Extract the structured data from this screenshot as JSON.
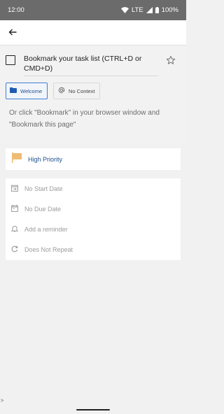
{
  "status_bar": {
    "time": "12:00",
    "network": "LTE",
    "battery": "100%"
  },
  "icons": {
    "back": "arrow-left-icon",
    "star": "star-outline-icon",
    "welcome": "folder-icon",
    "context": "at-sign-icon",
    "priority": "flag-icon",
    "start_date": "calendar-arrow-icon",
    "due_date": "calendar-icon",
    "reminder": "bell-icon",
    "repeat": "repeat-icon"
  },
  "colors": {
    "accent": "#3f7fd4",
    "priority_flag": "#eebc74",
    "muted_text": "#9c9c9c"
  },
  "task": {
    "title": "Bookmark your task list (CTRL+D or CMD+D)",
    "completed": false,
    "starred": false
  },
  "chips": {
    "welcome_label": "Welcome",
    "context_label": "No Context"
  },
  "hint": "Or click \"Bookmark\" in your browser window and \"Bookmark this page\"",
  "priority": {
    "label": "High Priority"
  },
  "dates": {
    "start": "No Start Date",
    "due": "No Due Date",
    "reminder": "Add a reminder",
    "repeat": "Does Not Repeat"
  },
  "footer": {
    "caret": ">"
  }
}
